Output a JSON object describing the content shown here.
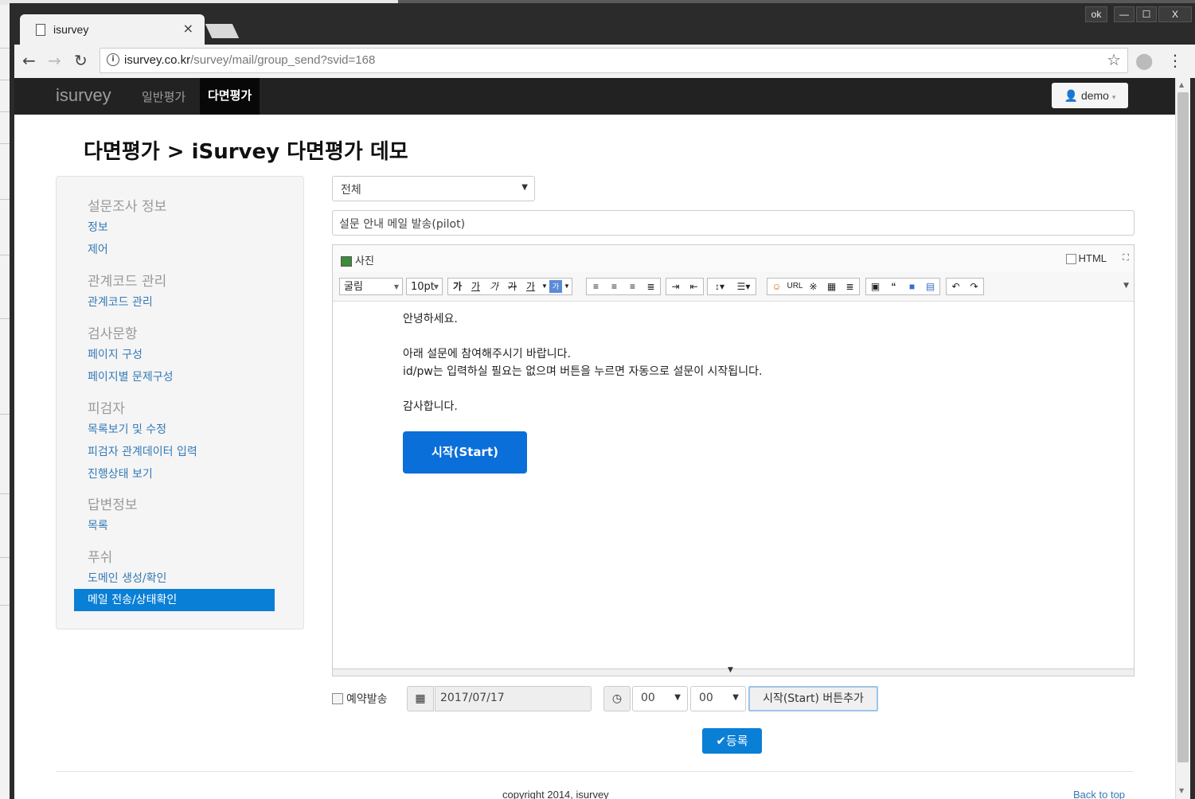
{
  "browser": {
    "window_controls": {
      "ok": "ok",
      "minimize": "—",
      "maximize": "☐",
      "close": "X"
    },
    "tab_title": "isurvey",
    "tab_close": "×",
    "url_domain": "isurvey.co.kr",
    "url_path": "/survey/mail/group_send?svid=168"
  },
  "navbar": {
    "brand": "isurvey",
    "items": [
      "일반평가",
      "다면평가"
    ],
    "user": "demo"
  },
  "page_title": "다면평가 > iSurvey 다면평가 데모",
  "sidebar": {
    "sections": [
      {
        "heading": "설문조사 정보",
        "items": [
          "정보",
          "제어"
        ]
      },
      {
        "heading": "관계코드 관리",
        "items": [
          "관계코드 관리"
        ]
      },
      {
        "heading": "검사문항",
        "items": [
          "페이지 구성",
          "페이지별 문제구성"
        ]
      },
      {
        "heading": "피검자",
        "items": [
          "목록보기 및 수정",
          "피검자 관계데이터 입력",
          "진행상태 보기"
        ]
      },
      {
        "heading": "답변정보",
        "items": [
          "목록"
        ]
      },
      {
        "heading": "푸쉬",
        "items": [
          "도메인 생성/확인",
          "메일 전송/상태확인"
        ]
      }
    ],
    "active_item": "메일 전송/상태확인"
  },
  "form": {
    "group_select": "전체",
    "subject": "설문 안내 메일 발송(pilot)",
    "editor": {
      "photo_label": "사진",
      "html_label": "HTML",
      "font_select": "굴림",
      "size_select": "10pt",
      "toolbar": {
        "group1": [
          "가",
          "가",
          "가",
          "가",
          "가"
        ],
        "url": "URL",
        "quote": "“"
      },
      "body_lines": [
        "안녕하세요.",
        "",
        "아래 설문에 참여해주시기 바랍니다.",
        "id/pw는 입력하실 필요는 없으며 버튼을 누르면 자동으로 설문이 시작됩니다.",
        "",
        "감사합니다."
      ],
      "start_button": "시작(Start)"
    },
    "reserve_label": "예약발송",
    "date": "2017/07/17",
    "hour": "00",
    "minute": "00",
    "add_button": "시작(Start) 버튼추가",
    "register_button": "✔등록"
  },
  "footer": {
    "copyright": "copyright 2014, isurvey",
    "back_to_top": "Back to top"
  }
}
